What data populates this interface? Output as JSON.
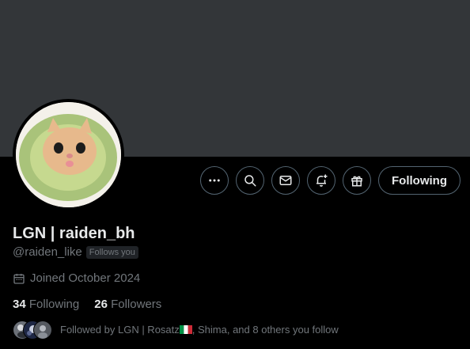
{
  "profile": {
    "display_name": "LGN | raiden_bh",
    "handle": "@raiden_like",
    "follows_you_badge": "Follows you",
    "joined": "Joined October 2024"
  },
  "actions": {
    "more_icon": "more-dots-icon",
    "search_icon": "search-icon",
    "message_icon": "envelope-icon",
    "notify_icon": "bell-plus-icon",
    "gift_icon": "gift-icon",
    "following_label": "Following"
  },
  "stats": {
    "following_count": "34",
    "following_label": "Following",
    "followers_count": "26",
    "followers_label": "Followers"
  },
  "followed_by": {
    "prefix": "Followed by LGN | Rosatz",
    "suffix": ", Shima, and 8 others you follow",
    "flag": "italy-flag"
  },
  "colors": {
    "banner": "#333639",
    "background": "#000000",
    "text_primary": "#e7e9ea",
    "text_secondary": "#71767b",
    "border": "#536471"
  }
}
